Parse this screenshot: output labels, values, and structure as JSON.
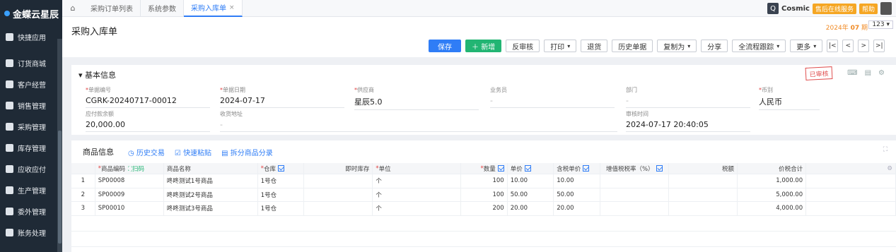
{
  "sidebar": {
    "logo": "金蝶云星辰",
    "quick": "快捷应用",
    "items": [
      "订货商城",
      "客户经营",
      "销售管理",
      "采购管理",
      "库存管理",
      "应收应付",
      "生产管理",
      "委外管理",
      "账务处理"
    ]
  },
  "topbar": {
    "tabs": [
      "采购订单列表",
      "系统参数",
      "采购入库单"
    ],
    "active_tab": "采购入库单",
    "cosmic": "Cosmic",
    "after_sales": "售后在线服务",
    "help": "帮助"
  },
  "header": {
    "title": "采购入库单",
    "period_prefix": "2024年",
    "period_num": "07",
    "period_suffix": "期",
    "page": "123"
  },
  "toolbar": [
    "保存",
    "新增",
    "反审核",
    "打印",
    "退货",
    "历史单据",
    "复制为",
    "分享",
    "全流程跟踪",
    "更多"
  ],
  "basic": {
    "title": "基本信息",
    "stamp": "已审核",
    "fields": [
      {
        "label": "单据编号",
        "value": "CGRK-20240717-00012",
        "required": true
      },
      {
        "label": "单据日期",
        "value": "2024-07-17",
        "required": true
      },
      {
        "label": "供应商",
        "value": "星辰5.0",
        "required": true
      },
      {
        "label": "业务员",
        "value": "-",
        "required": false
      },
      {
        "label": "部门",
        "value": "-",
        "required": false
      },
      {
        "label": "币别",
        "value": "人民币",
        "required": true
      },
      {
        "label": "应付款余额",
        "value": "20,000.00",
        "required": false
      },
      {
        "label": "收货地址",
        "value": "-",
        "required": false
      },
      {
        "label": "审核时间",
        "value": "2024-07-17 20:40:05",
        "required": false
      }
    ]
  },
  "goods": {
    "title": "商品信息",
    "links": [
      "历史交易",
      "快速粘贴",
      "拆分商品分录"
    ],
    "columns": [
      "商品编码",
      "商品名称",
      "仓库",
      "即时库存",
      "单位",
      "数量",
      "单价",
      "含税单价",
      "增值税税率（%）",
      "税额",
      "价税合计"
    ],
    "scan": "扫码",
    "rows": [
      {
        "no": "1",
        "code": "SP00008",
        "name": "咚咚测试1号商品",
        "warehouse": "1号仓",
        "stock": "",
        "unit": "个",
        "qty": "100",
        "price": "10.00",
        "tax_price": "10.00",
        "tax_rate": "",
        "tax": "",
        "total": "1,000.00"
      },
      {
        "no": "2",
        "code": "SP00009",
        "name": "咚咚测试2号商品",
        "warehouse": "1号仓",
        "stock": "",
        "unit": "个",
        "qty": "100",
        "price": "50.00",
        "tax_price": "50.00",
        "tax_rate": "",
        "tax": "",
        "total": "5,000.00"
      },
      {
        "no": "3",
        "code": "SP00010",
        "name": "咚咚测试3号商品",
        "warehouse": "1号仓",
        "stock": "",
        "unit": "个",
        "qty": "200",
        "price": "20.00",
        "tax_price": "20.00",
        "tax_rate": "",
        "tax": "",
        "total": "4,000.00"
      }
    ]
  }
}
